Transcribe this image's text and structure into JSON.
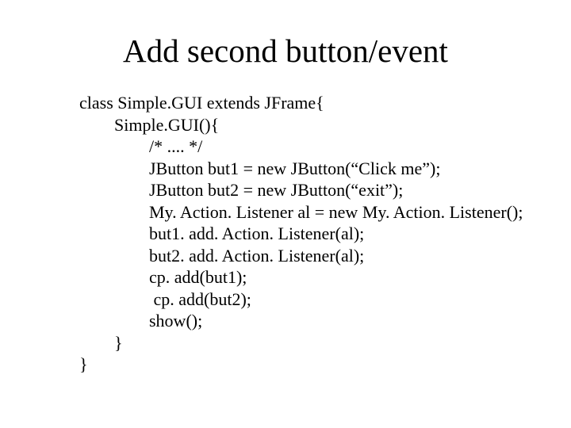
{
  "title": "Add second button/event",
  "code": {
    "l0": "class Simple.GUI extends JFrame{",
    "l1": "        Simple.GUI(){",
    "l2": "                /* .... */",
    "l3": "                JButton but1 = new JButton(“Click me”);",
    "l4": "                JButton but2 = new JButton(“exit”);",
    "l5": "                My. Action. Listener al = new My. Action. Listener();",
    "l6": "                but1. add. Action. Listener(al);",
    "l7": "                but2. add. Action. Listener(al);",
    "l8": "                cp. add(but1);",
    "l9": "                 cp. add(but2);",
    "l10": "                show();",
    "l11": "        }",
    "l12": "}"
  }
}
